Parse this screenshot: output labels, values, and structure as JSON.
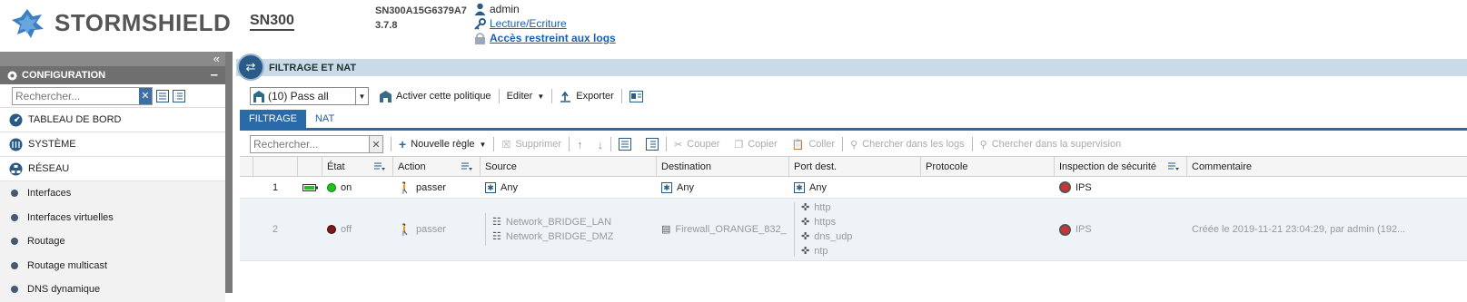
{
  "header": {
    "brand": "STORMSHIELD",
    "model": "SN300",
    "serial": "SN300A15G6379A7",
    "version": "3.7.8",
    "user": "admin",
    "access_mode": "Lecture/Ecriture",
    "restricted_logs": "Accès restreint aux logs"
  },
  "sidebar": {
    "section_title": "CONFIGURATION",
    "search_placeholder": "Rechercher...",
    "items": [
      {
        "label": "TABLEAU DE BORD"
      },
      {
        "label": "SYSTÈME"
      },
      {
        "label": "RÉSEAU"
      }
    ],
    "subitems": [
      {
        "label": "Interfaces"
      },
      {
        "label": "Interfaces virtuelles"
      },
      {
        "label": "Routage"
      },
      {
        "label": "Routage multicast"
      },
      {
        "label": "DNS dynamique"
      }
    ]
  },
  "main": {
    "title": "FILTRAGE ET NAT",
    "policy_value": "(10) Pass all",
    "activate_label": "Activer cette politique",
    "edit_label": "Editer",
    "export_label": "Exporter",
    "tabs": [
      {
        "label": "FILTRAGE",
        "active": true
      },
      {
        "label": "NAT",
        "active": false
      }
    ],
    "search_placeholder": "Rechercher...",
    "actions": {
      "new_rule": "Nouvelle règle",
      "delete": "Supprimer",
      "cut": "Couper",
      "copy": "Copier",
      "paste": "Coller",
      "search_logs": "Chercher dans les logs",
      "search_supervision": "Chercher dans la supervision"
    },
    "columns": [
      "",
      "",
      "État",
      "Action",
      "Source",
      "Destination",
      "Port dest.",
      "Protocole",
      "Inspection de sécurité",
      "Commentaire"
    ],
    "rows": [
      {
        "num": "1",
        "state": "on",
        "action": "passer",
        "source": [
          "Any"
        ],
        "destination": "Any",
        "ports": [
          "Any"
        ],
        "protocol": "",
        "inspection": "IPS",
        "comment": ""
      },
      {
        "num": "2",
        "state": "off",
        "action": "passer",
        "source": [
          "Network_BRIDGE_LAN",
          "Network_BRIDGE_DMZ"
        ],
        "destination": "Firewall_ORANGE_832_",
        "ports": [
          "http",
          "https",
          "dns_udp",
          "ntp"
        ],
        "protocol": "",
        "inspection": "IPS",
        "comment": "Créée le 2019-11-21 23:04:29, par admin (192...."
      }
    ]
  },
  "colors": {
    "accent": "#2a6aa9",
    "sidebar_header": "#6f6f6f",
    "title_bar": "#c9dbe9",
    "status_on": "#1fc41f",
    "status_off": "#7a1a1a",
    "link": "#1a5fb4"
  }
}
